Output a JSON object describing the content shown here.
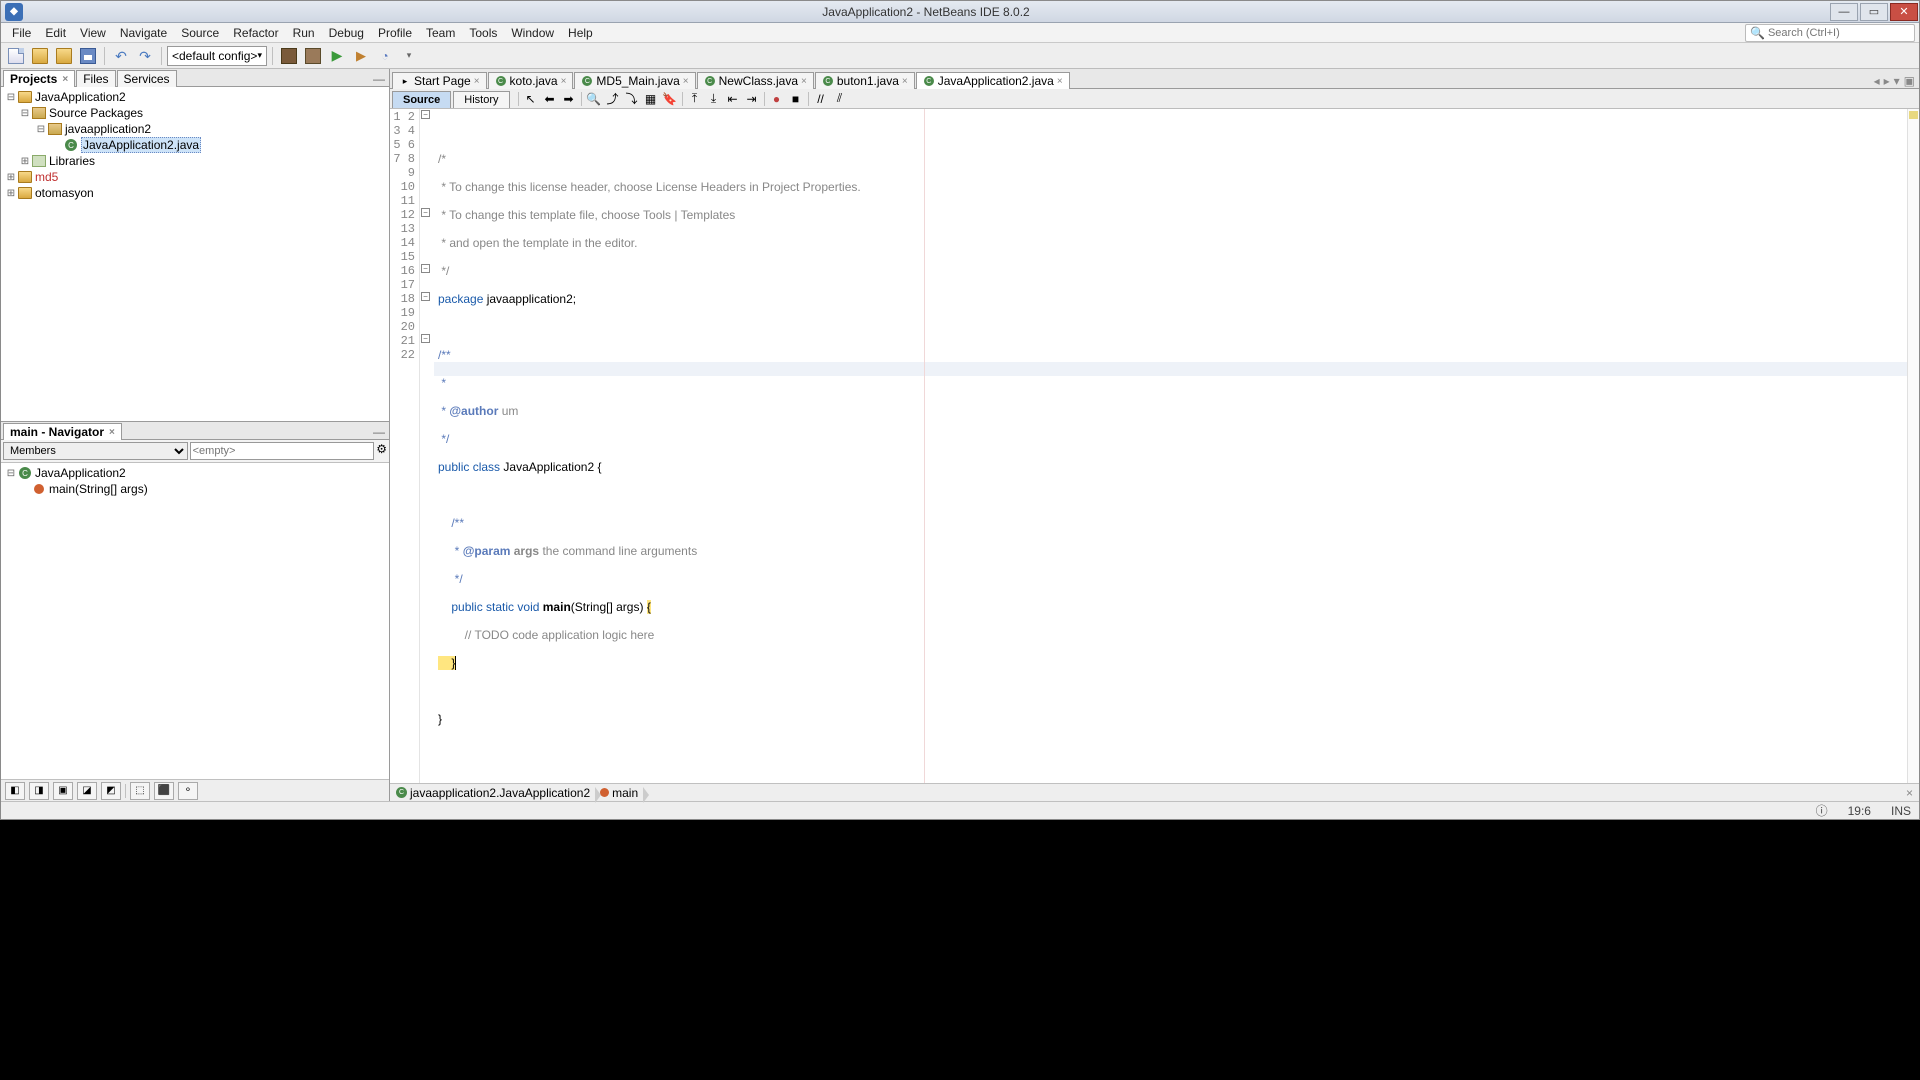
{
  "title": "JavaApplication2 - NetBeans IDE 8.0.2",
  "menu": [
    "File",
    "Edit",
    "View",
    "Navigate",
    "Source",
    "Refactor",
    "Run",
    "Debug",
    "Profile",
    "Team",
    "Tools",
    "Window",
    "Help"
  ],
  "search_placeholder": "Search (Ctrl+I)",
  "config_combo": "<default config>",
  "left_tabs": [
    "Projects",
    "Files",
    "Services"
  ],
  "projects": {
    "root": "JavaApplication2",
    "src": "Source Packages",
    "pkg": "javaapplication2",
    "file": "JavaApplication2.java",
    "lib": "Libraries",
    "p2": "md5",
    "p3": "otomasyon"
  },
  "navigator": {
    "title": "main - Navigator",
    "view": "Members",
    "filter": "<empty>",
    "cls": "JavaApplication2",
    "m1": "main(String[] args)"
  },
  "editor_tabs": [
    {
      "label": "Start Page",
      "icon": "page"
    },
    {
      "label": "koto.java",
      "icon": "class"
    },
    {
      "label": "MD5_Main.java",
      "icon": "class"
    },
    {
      "label": "NewClass.java",
      "icon": "class"
    },
    {
      "label": "buton1.java",
      "icon": "class"
    },
    {
      "label": "JavaApplication2.java",
      "icon": "class",
      "active": true
    }
  ],
  "sub_tabs": {
    "source": "Source",
    "history": "History"
  },
  "code": {
    "l1": "/*",
    "l2": " * To change this license header, choose License Headers in Project Properties.",
    "l3": " * To change this template file, choose Tools | Templates",
    "l4": " * and open the template in the editor.",
    "l5": " */",
    "l6a": "package",
    "l6b": " javaapplication2;",
    "l7": "",
    "l8": "/**",
    "l9": " *",
    "l10a": " * ",
    "l10b": "@author",
    "l10c": " um",
    "l11": " */",
    "l12a": "public",
    "l12b": "class",
    "l12c": "JavaApplication2",
    "l12d": " {",
    "l13": "",
    "l14": "    /**",
    "l15a": "     * ",
    "l15b": "@param",
    "l15c": " ",
    "l15d": "args",
    "l15e": " the command line arguments",
    "l16": "     */",
    "l17a": "    ",
    "l17b": "public",
    "l17c": "static",
    "l17d": "void",
    "l17e": "main",
    "l17f": "(String[] args) ",
    "l17g": "{",
    "l18": "        // TODO code application logic here",
    "l19": "    }",
    "l20": "    ",
    "l21": "}",
    "l22": ""
  },
  "breadcrumb": {
    "cls": "javaapplication2.JavaApplication2",
    "m": "main"
  },
  "status": {
    "pos": "19:6",
    "ins": "INS"
  }
}
